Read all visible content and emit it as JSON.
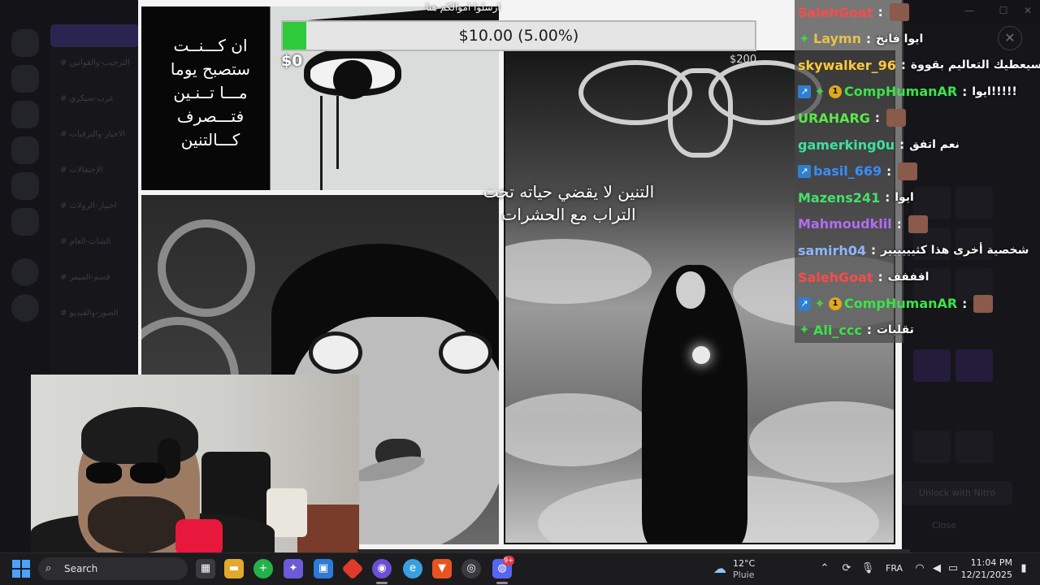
{
  "window": {
    "minimize": "—",
    "maximize": "☐",
    "close": "✕",
    "dialog_close": "✕"
  },
  "discord": {
    "channels": [
      "# الترحيب-والقوانين",
      "# عرب-سيكري",
      "# الاخبار-والترقيات",
      "# الإحتفالات",
      "# اختيار-الرولات",
      "# الشات-العام",
      "# قسم-الميمز",
      "# الصور-والفيديو"
    ],
    "unlock_nitro": "Unlock with Nitro",
    "close_label": "Close"
  },
  "poem": {
    "lines": [
      "ان كـــنــت",
      "ستصبح يوما",
      "مـــا تــنـين",
      "فتـــصرف",
      "كـــالتنين"
    ]
  },
  "dragon_text": {
    "lines": [
      "التنين لا يقضي حياته تحت",
      "التراب مع الحشرات"
    ]
  },
  "goal": {
    "title": "ارسلوا اموالكم هنا",
    "amount_text": "$10.00 (5.00%)",
    "min": "$0",
    "max": "$200",
    "progress": 0.05,
    "fill_color": "#2fcb3c"
  },
  "chat": [
    {
      "user": "SalehGoat",
      "color": "#ff4a4a",
      "badges": [],
      "msg": "",
      "emote": true
    },
    {
      "user": "Laymn",
      "color": "#e6c34a",
      "badges": [
        "star"
      ],
      "msg": "ايوا فانخ",
      "emote": false
    },
    {
      "user": "skywalker_96",
      "color": "#ffc83a",
      "badges": [],
      "msg": "سيعطيك التعاليم بقووة",
      "emote": false
    },
    {
      "user": "CompHumanAR",
      "color": "#3be34a",
      "badges": [
        "prime",
        "star",
        "coin"
      ],
      "msg": "ايوا!!!!!",
      "emote": false
    },
    {
      "user": "URAHARG",
      "color": "#5be84b",
      "badges": [],
      "msg": "",
      "emote": true
    },
    {
      "user": "gamerking0u",
      "color": "#3de0a0",
      "badges": [],
      "msg": "نعم اتفق",
      "emote": false
    },
    {
      "user": "basil_669",
      "color": "#3a8cff",
      "badges": [
        "prime"
      ],
      "msg": "",
      "emote": true
    },
    {
      "user": "Mazens241",
      "color": "#45e06c",
      "badges": [],
      "msg": "ايوا",
      "emote": false
    },
    {
      "user": "Mahmoudklil",
      "color": "#b26cf2",
      "badges": [],
      "msg": "",
      "emote": true
    },
    {
      "user": "samirh04",
      "color": "#8fb7ff",
      "badges": [],
      "msg": "شخصية أخرى هذا كثيييييير",
      "emote": false
    },
    {
      "user": "SalehGoat",
      "color": "#ff4a4a",
      "badges": [],
      "msg": "افففف",
      "emote": false
    },
    {
      "user": "CompHumanAR",
      "color": "#3be34a",
      "badges": [
        "prime",
        "star",
        "coin"
      ],
      "msg": "",
      "emote": true
    },
    {
      "user": "Ali_ccc",
      "color": "#3be34a",
      "badges": [
        "star"
      ],
      "msg": "تقلبات",
      "emote": false
    }
  ],
  "taskbar": {
    "search_label": "Search",
    "weather_temp": "12°C",
    "weather_desc": "Pluie",
    "language": "FRA",
    "time": "11:04 PM",
    "date": "12/21/2025",
    "discord_badge": "9+"
  }
}
